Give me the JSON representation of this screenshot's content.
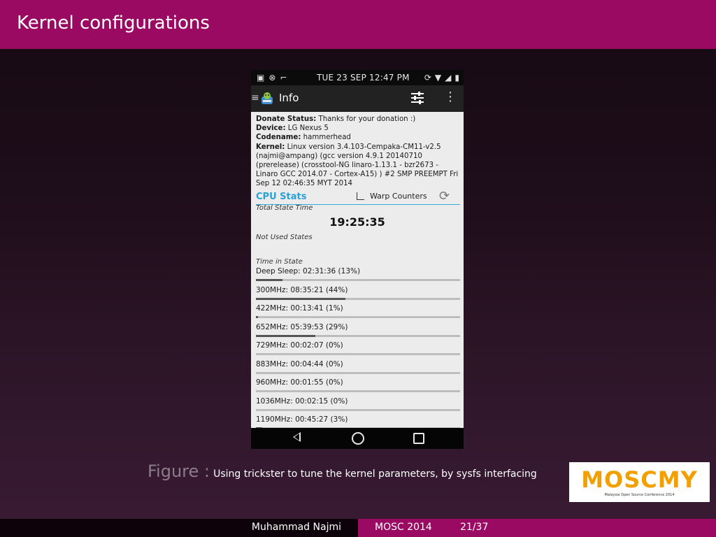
{
  "slide": {
    "title": "Kernel configurations"
  },
  "phone": {
    "statusbar": {
      "time": "TUE 23 SEP 12:47 PM"
    },
    "actionbar": {
      "title": "Info"
    },
    "info": [
      {
        "label": "Donate Status:",
        "value": " Thanks for your donation :)"
      },
      {
        "label": "Device:",
        "value": " LG Nexus 5"
      },
      {
        "label": "Codename:",
        "value": " hammerhead"
      },
      {
        "label": "Kernel:",
        "value": " Linux version 3.4.103-Cempaka-CM11-v2.5 (najmi@ampang) (gcc version 4.9.1 20140710 (prerelease) (crosstool-NG linaro-1.13.1 - bzr2673 - Linaro GCC 2014.07 - Cortex-A15) ) #2 SMP PREEMPT Fri Sep 12 02:46:35 MYT 2014"
      }
    ],
    "cpu_stats": {
      "title": "CPU Stats",
      "warp_label": "Warp Counters",
      "total_state_label": "Total State Time",
      "total_state_value": "19:25:35",
      "not_used_label": "Not Used States",
      "time_in_state_label": "Time in State",
      "states": [
        {
          "text": "Deep Sleep: 02:31:36 (13%)",
          "fraction": 0.13
        },
        {
          "text": "300MHz: 08:35:21 (44%)",
          "fraction": 0.44
        },
        {
          "text": "422MHz: 00:13:41 (1%)",
          "fraction": 0.01
        },
        {
          "text": "652MHz: 05:39:53 (29%)",
          "fraction": 0.29
        },
        {
          "text": "729MHz: 00:02:07 (0%)",
          "fraction": 0.0
        },
        {
          "text": "883MHz: 00:04:44 (0%)",
          "fraction": 0.0
        },
        {
          "text": "960MHz: 00:01:55 (0%)",
          "fraction": 0.0
        },
        {
          "text": "1036MHz: 00:02:15 (0%)",
          "fraction": 0.0
        },
        {
          "text": "1190MHz: 00:45:27 (3%)",
          "fraction": 0.03
        }
      ]
    }
  },
  "figure": {
    "label": "Figure :",
    "caption": "Using trickster to tune the kernel parameters, by sysfs interfacing"
  },
  "logo": {
    "word": "MOSCMY",
    "subtitle": "Malaysia Open Source Conference 2014"
  },
  "footer": {
    "author": "Muhammad Najmi",
    "event": "MOSC 2014",
    "page": "21/37"
  },
  "colors": {
    "accent": "#9a0a63",
    "cpu_title": "#2aa2d6",
    "logo": "#f2a000"
  }
}
